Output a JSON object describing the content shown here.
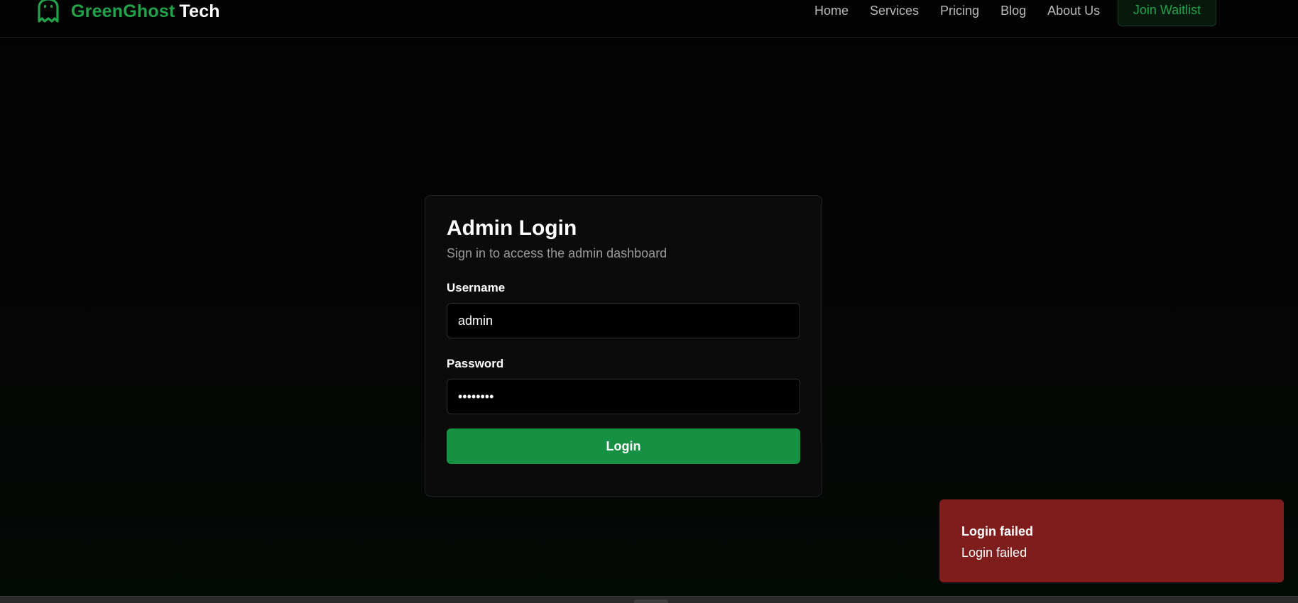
{
  "header": {
    "brand_primary": "GreenGhost",
    "brand_secondary": "Tech",
    "brand_icon": "ghost-icon",
    "nav": [
      "Home",
      "Services",
      "Pricing",
      "Blog",
      "About Us"
    ],
    "cta_label": "Join Waitlist"
  },
  "login": {
    "title": "Admin Login",
    "subtitle": "Sign in to access the admin dashboard",
    "username_label": "Username",
    "username_value": "admin",
    "password_label": "Password",
    "password_value": "password",
    "submit_label": "Login"
  },
  "toast": {
    "title": "Login failed",
    "description": "Login failed"
  },
  "colors": {
    "accent": "#22a24a",
    "button": "#169143",
    "error": "#7f1d1d",
    "background": "#030303"
  }
}
